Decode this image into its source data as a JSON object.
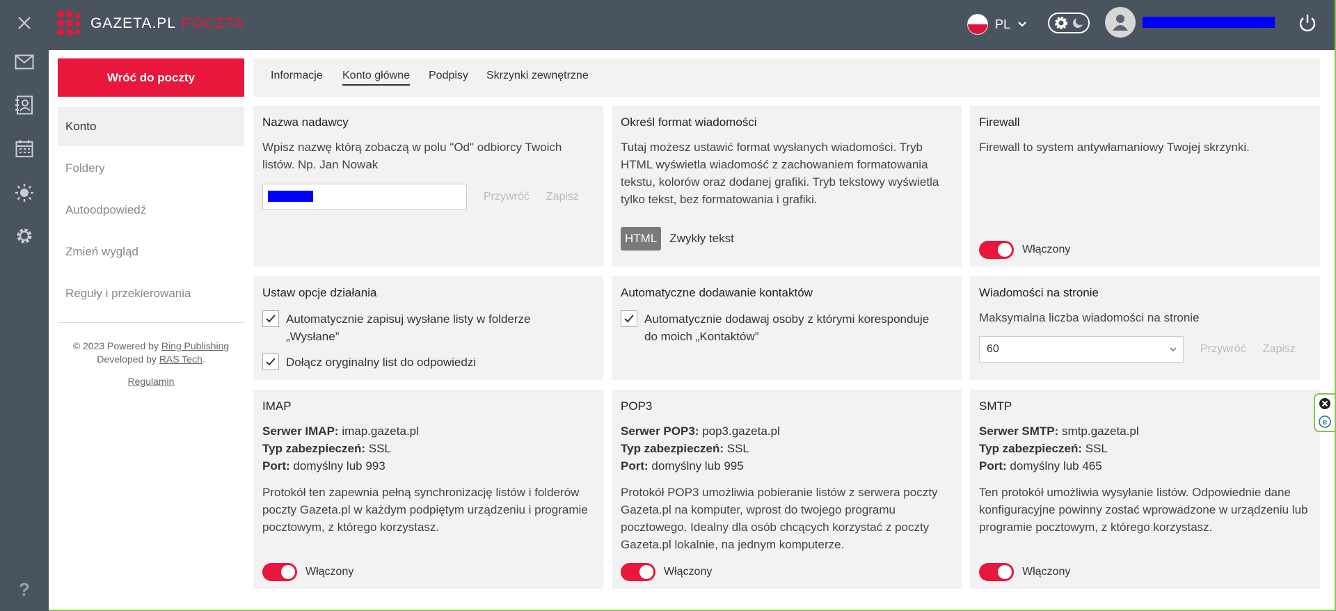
{
  "brand": {
    "name": "GAZETA.PL",
    "product": "POCZTA"
  },
  "header": {
    "lang": "PL"
  },
  "nav": {
    "back_label": "Wróć do poczty",
    "items": [
      {
        "label": "Konto",
        "active": true
      },
      {
        "label": "Foldery"
      },
      {
        "label": "Autoodpowiedź"
      },
      {
        "label": "Zmień wygląd"
      },
      {
        "label": "Reguły i przekierowania"
      }
    ],
    "footer": {
      "powered_prefix": "© 2023 Powered by",
      "powered_link": "Ring Publishing",
      "developed_prefix": "Developed by",
      "developed_link": "RAS Tech",
      "developed_suffix": ".",
      "regulamin": "Regulamin"
    }
  },
  "tabs": [
    {
      "label": "Informacje"
    },
    {
      "label": "Konto główne",
      "active": true
    },
    {
      "label": "Podpisy"
    },
    {
      "label": "Skrzynki zewnętrzne"
    }
  ],
  "cards": {
    "sender": {
      "title": "Nazwa nadawcy",
      "desc": "Wpisz nazwę którą zobaczą w polu \"Od\" odbiorcy Twoich listów. Np. Jan Nowak",
      "restore": "Przywróć",
      "save": "Zapisz"
    },
    "format": {
      "title": "Określ format wiadomości",
      "desc": "Tutaj możesz ustawić format wysłanych wiadomości. Tryb HTML wyświetla wiadomość z zachowaniem formatowania tekstu, kolorów oraz dodanej grafiki. Tryb tekstowy wyświetla tylko tekst, bez formatowania i grafiki.",
      "html": "HTML",
      "plain": "Zwykły tekst"
    },
    "firewall": {
      "title": "Firewall",
      "desc": "Firewall to system antywłamaniowy Twojej skrzynki.",
      "state": "Włączony"
    },
    "options": {
      "title": "Ustaw opcje działania",
      "opt1": "Automatycznie zapisuj wysłane listy w folderze „Wysłane”",
      "opt2": "Dołącz oryginalny list do odpowiedzi"
    },
    "contacts": {
      "title": "Automatyczne dodawanie kontaktów",
      "opt1": "Automatycznie dodawaj osoby z którymi koresponduje do moich „Kontaktów”"
    },
    "perpage": {
      "title": "Wiadomości na stronie",
      "desc": "Maksymalna liczba wiadomości na stronie",
      "value": "60",
      "restore": "Przywróć",
      "save": "Zapisz"
    },
    "imap": {
      "title": "IMAP",
      "server_label": "Serwer IMAP:",
      "server": "imap.gazeta.pl",
      "sec_label": "Typ zabezpieczeń:",
      "sec": "SSL",
      "port_label": "Port:",
      "port": "domyślny lub 993",
      "desc": "Protokół ten zapewnia pełną synchronizację listów i folderów poczty Gazeta.pl w każdym podpiętym urządzeniu i programie pocztowym, z którego korzystasz.",
      "state": "Włączony"
    },
    "pop3": {
      "title": "POP3",
      "server_label": "Serwer POP3:",
      "server": "pop3.gazeta.pl",
      "sec_label": "Typ zabezpieczeń:",
      "sec": "SSL",
      "port_label": "Port:",
      "port": "domyślny lub 995",
      "desc": "Protokół POP3 umożliwia pobieranie listów z serwera poczty Gazeta.pl na komputer, wprost do twojego programu pocztowego. Idealny dla osób chcących korzystać z poczty Gazeta.pl lokalnie, na jednym komputerze.",
      "state": "Włączony"
    },
    "smtp": {
      "title": "SMTP",
      "server_label": "Serwer SMTP:",
      "server": "smtp.gazeta.pl",
      "sec_label": "Typ zabezpieczeń:",
      "sec": "SSL",
      "port_label": "Port:",
      "port": "domyślny lub 465",
      "desc": "Ten protokół umożliwia wysyłanie listów. Odpowiednie dane konfiguracyjne powinny zostać wprowadzone w urządzeniu lub programie pocztowym, z którego korzystasz.",
      "state": "Włączony"
    }
  },
  "colors": {
    "accent": "#e8173b",
    "rail": "#4a545f",
    "card": "#f2f2f2"
  },
  "icons": [
    "close-icon",
    "mail-icon",
    "contacts-icon",
    "calendar-icon",
    "weather-icon",
    "settings-icon",
    "help-icon",
    "gear-icon",
    "moon-icon",
    "user-icon",
    "power-icon",
    "chevron-down-icon",
    "check-icon"
  ]
}
